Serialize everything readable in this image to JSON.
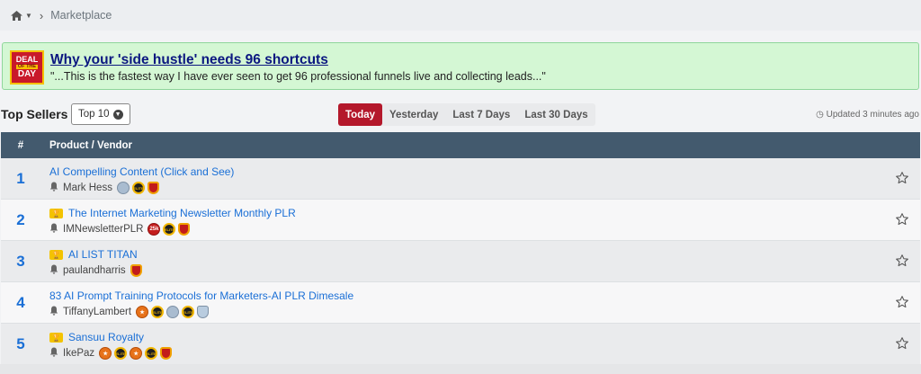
{
  "breadcrumb": {
    "current": "Marketplace"
  },
  "deal": {
    "logo_line1": "DEAL",
    "logo_line2": "OF THE",
    "logo_line3": "DAY",
    "title": "Why your 'side hustle' needs 96 shortcuts",
    "quote": "\"...This is the fastest way I have ever seen to get 96 professional funnels live and collecting leads...\""
  },
  "top_sellers": {
    "title": "Top Sellers",
    "filter_label": "Top 10",
    "periods": [
      "Today",
      "Yesterday",
      "Last 7 Days",
      "Last 30 Days"
    ],
    "active_period": "Today",
    "updated": "Updated 3 minutes ago"
  },
  "table": {
    "headers": {
      "rank": "#",
      "product": "Product / Vendor"
    },
    "rows": [
      {
        "rank": "1",
        "product": "AI Compelling Content (Click and See)",
        "vendor": "Mark Hess",
        "trophy": false,
        "badges": [
          "silver",
          "gold",
          "shield"
        ]
      },
      {
        "rank": "2",
        "product": "The Internet Marketing Newsletter Monthly PLR",
        "vendor": "IMNewsletterPLR",
        "trophy": true,
        "badges": [
          "red",
          "gold",
          "shield"
        ]
      },
      {
        "rank": "3",
        "product": "AI LIST TITAN",
        "vendor": "paulandharris",
        "trophy": true,
        "badges": [
          "shield"
        ]
      },
      {
        "rank": "4",
        "product": "83 AI Prompt Training Protocols for Marketers-AI PLR Dimesale",
        "vendor": "TiffanyLambert",
        "trophy": false,
        "badges": [
          "orange",
          "gold",
          "silver",
          "gold",
          "shield-blue"
        ]
      },
      {
        "rank": "5",
        "product": "Sansuu Royalty",
        "vendor": "IkePaz",
        "trophy": true,
        "badges": [
          "orange",
          "gold",
          "orange",
          "gold",
          "shield"
        ]
      }
    ]
  },
  "colors": {
    "accent": "#b4182b",
    "link": "#1a6fd6",
    "header": "#435a6e",
    "deal_bg": "#d4f7d4"
  }
}
